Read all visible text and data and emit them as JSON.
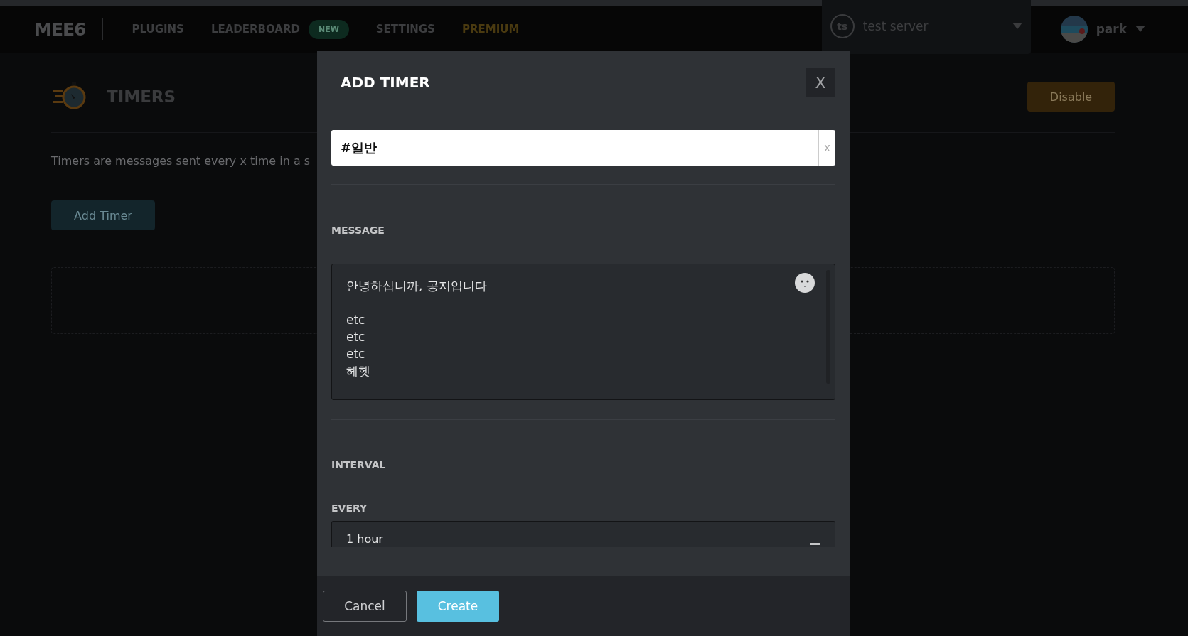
{
  "nav": {
    "logo": "MEE6",
    "items": [
      {
        "label": "PLUGINS",
        "kind": "plain"
      },
      {
        "label": "LEADERBOARD",
        "kind": "plain",
        "badge": "NEW"
      },
      {
        "label": "SETTINGS",
        "kind": "plain"
      },
      {
        "label": "PREMIUM",
        "kind": "premium"
      }
    ],
    "server": {
      "initials": "ts",
      "name": "test server"
    },
    "user": {
      "name": "park"
    }
  },
  "page": {
    "title": "TIMERS",
    "description": "Timers are messages sent every x time in a s",
    "add_button": "Add Timer",
    "disable_button": "Disable"
  },
  "modal": {
    "title": "ADD TIMER",
    "close": "X",
    "channel": {
      "value": "#일반",
      "clear": "x"
    },
    "message": {
      "label": "MESSAGE",
      "value": "안녕하십니까, 공지입니다\n\netc\netc\netc\n헤헷"
    },
    "interval": {
      "label": "INTERVAL"
    },
    "every": {
      "label": "EVERY",
      "value": "1 hour"
    },
    "buttons": [
      {
        "label": "Cancel",
        "kind": "secondary"
      },
      {
        "label": "Create",
        "kind": "primary"
      }
    ]
  }
}
